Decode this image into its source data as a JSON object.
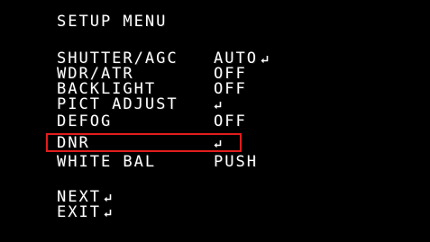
{
  "menu": {
    "title": "SETUP MENU",
    "items": [
      {
        "label": "SHUTTER/AGC",
        "value": "AUTO",
        "has_enter": true
      },
      {
        "label": "WDR/ATR",
        "value": "OFF",
        "has_enter": false
      },
      {
        "label": "BACKLIGHT",
        "value": "OFF",
        "has_enter": false
      },
      {
        "label": "PICT ADJUST",
        "value": "",
        "has_enter": true
      },
      {
        "label": "DEFOG",
        "value": "OFF",
        "has_enter": false
      },
      {
        "label": "DNR",
        "value": "",
        "has_enter": true
      },
      {
        "label": "WHITE BAL",
        "value": "PUSH",
        "has_enter": false
      }
    ],
    "next_label": "NEXT",
    "exit_label": "EXIT",
    "selected_item": "DNR"
  },
  "colors": {
    "background": "#000000",
    "text": "#ffffff",
    "highlight": "#e21c1c"
  },
  "icons": {
    "enter": "enter-return-icon"
  }
}
